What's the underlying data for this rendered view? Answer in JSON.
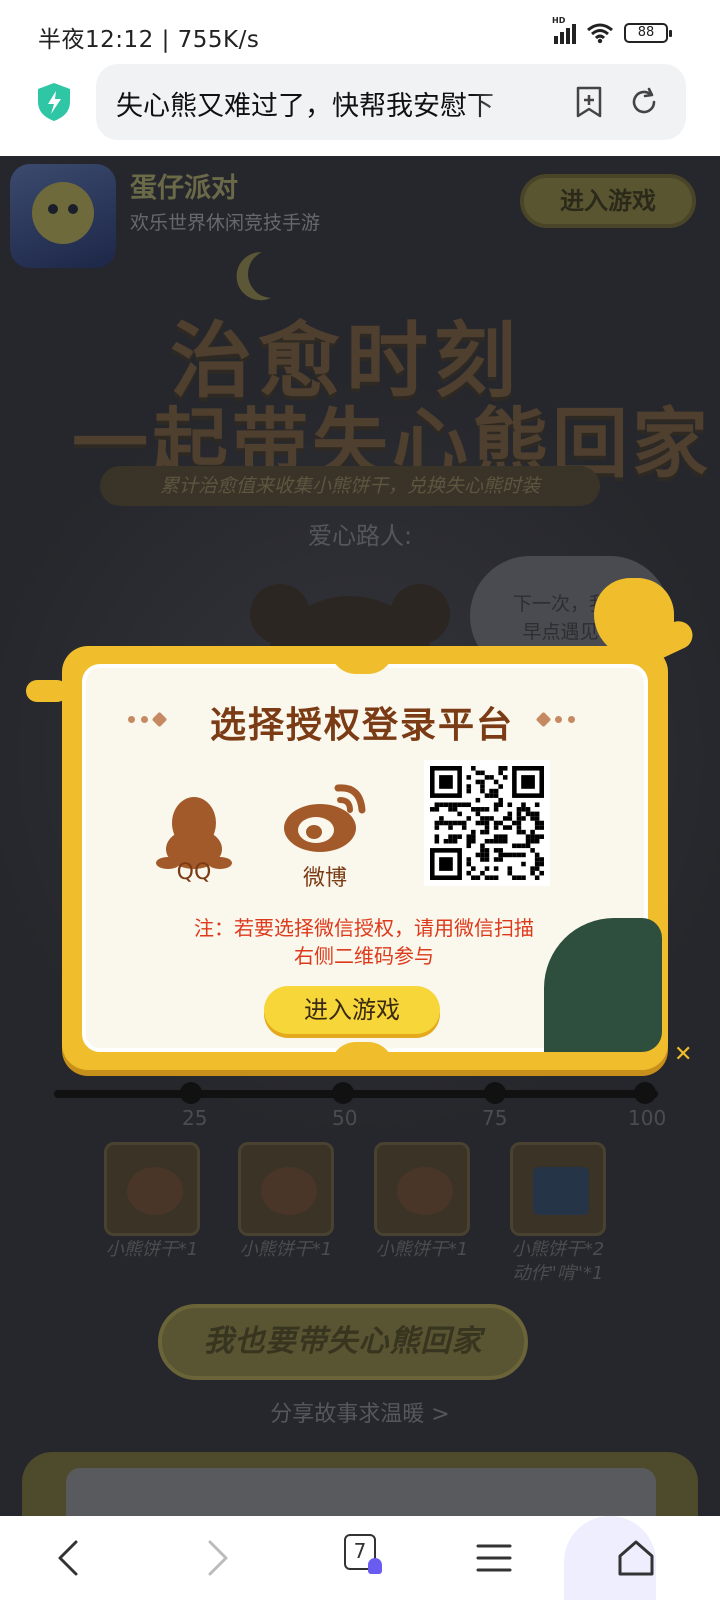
{
  "status_bar": {
    "time": "半夜12:12 | 755K/s",
    "network_label": "HD",
    "battery": "88"
  },
  "browser": {
    "url_text": "失心熊又难过了，快帮我安慰下",
    "tab_count": "7"
  },
  "page": {
    "app_banner": {
      "name": "蛋仔派对",
      "subtitle": "欢乐世界休闲竞技手游",
      "enter_label": "进入游戏"
    },
    "hero": {
      "title_line1": "治愈时刻",
      "title_line2": "一起带失心熊回家",
      "subtitle": "累计治愈值来收集小熊饼干，兑换失心熊时装"
    },
    "helper_label": "爱心路人:",
    "speech_bubble": [
      "下一次，我想",
      "早点遇见你"
    ],
    "progress": {
      "ticks": [
        "25",
        "50",
        "75",
        "100"
      ],
      "rewards": [
        {
          "label": "小熊饼干*1"
        },
        {
          "label": "小熊饼干*1"
        },
        {
          "label": "小熊饼干*1"
        },
        {
          "label": "小熊饼干*2",
          "label2": "动作\"啃\"*1"
        }
      ]
    },
    "share_button": "我也要带失心熊回家",
    "share_link": "分享故事求温暖 >"
  },
  "modal": {
    "title": "选择授权登录平台",
    "options": [
      {
        "label": "QQ",
        "icon": "qq-penguin-icon"
      },
      {
        "label": "微博",
        "icon": "weibo-icon"
      }
    ],
    "note_line1": "注：若要选择微信授权，请用微信扫描",
    "note_line2": "右侧二维码参与",
    "enter_label": "进入游戏"
  },
  "colors": {
    "modal_frame": "#f0be2c",
    "title_brown": "#7a3b15",
    "note_red": "#dd3a1c",
    "button_yellow": "#f7d63a"
  }
}
